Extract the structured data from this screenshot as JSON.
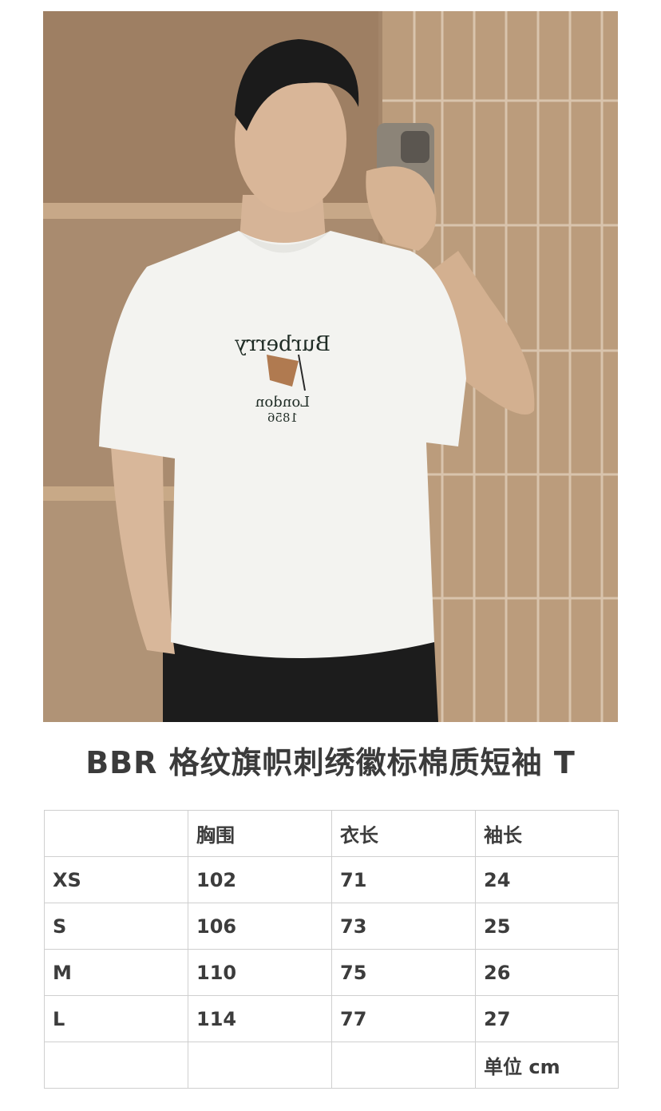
{
  "title": "BBR 格纹旗帜刺绣徽标棉质短袖 T",
  "photo": {
    "shirt_print": {
      "brand": "Burberry",
      "city": "London",
      "year": "1856"
    }
  },
  "size_table": {
    "headers": [
      "",
      "胸围",
      "衣长",
      "袖长"
    ],
    "rows": [
      [
        "XS",
        "102",
        "71",
        "24"
      ],
      [
        "S",
        "106",
        "73",
        "25"
      ],
      [
        "M",
        "110",
        "75",
        "26"
      ],
      [
        "L",
        "114",
        "77",
        "27"
      ]
    ],
    "footer": [
      "",
      "",
      "",
      "单位 cm"
    ]
  },
  "colors": {
    "text": "#3b3b3b",
    "border": "#cfcfcf",
    "wall": "#a88a6c",
    "tile": "#b99a7a",
    "shirt": "#f4f4f1",
    "pants": "#1b1b1b"
  }
}
